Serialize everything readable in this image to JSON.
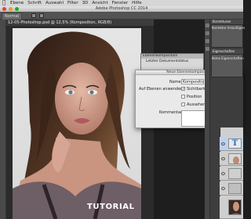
{
  "app": {
    "window_title": "Adobe Photoshop CC 2014",
    "menu": [
      "Ebene",
      "Schrift",
      "Auswahl",
      "Filter",
      "3D",
      "Ansicht",
      "Fenster",
      "Hilfe"
    ],
    "options_mode": "Normal",
    "document_tab": "12-05-Photoshop.psd @ 12,5% (Komposition, RGB/8)"
  },
  "overlay": {
    "tutorial_label": "TUTORIAL"
  },
  "comp_panel": {
    "title": "Ebenenkomposition",
    "row_label": "Letzter Dokumentstatus"
  },
  "dialog": {
    "title": "Neue Ebenenkomposition",
    "name_label": "Name:",
    "name_value": "Komposition 1",
    "apply_label": "Auf Ebenen anwenden:",
    "options": [
      {
        "label": "Sichtbarkeit",
        "checked": true
      },
      {
        "label": "Position",
        "checked": false
      },
      {
        "label": "Aussehen (Ebenenstil)",
        "checked": false
      }
    ],
    "comment_label": "Kommentar:"
  },
  "right_panels": {
    "tab1": "Korrekturen",
    "tab1b": "Korrektur hinzufügen",
    "tab2": "Eigenschaften",
    "tab2b": "Keine Eigenschaften"
  },
  "layers": [
    {
      "kind": "text",
      "glyph": "T"
    },
    {
      "kind": "image"
    },
    {
      "kind": "image"
    }
  ],
  "colors": {
    "accent": "#2a6dc1",
    "panel_dark": "#3d3d3d",
    "dialog_bg": "#e9e9e9",
    "menubar": "#d6d6d6"
  }
}
